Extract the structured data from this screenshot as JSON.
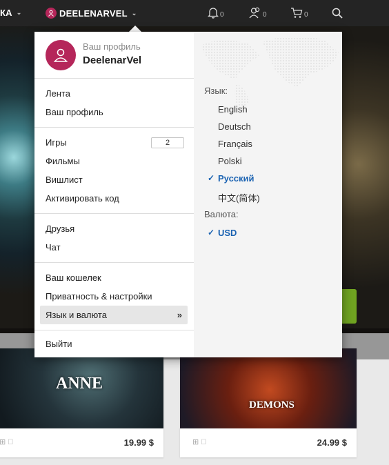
{
  "topbar": {
    "store_label": "КА",
    "username": "DEELENARVEL",
    "notifications_count": "0",
    "friends_count": "0",
    "cart_count": "0"
  },
  "profile": {
    "subtitle": "Ваш профиль",
    "name": "DeelenarVel"
  },
  "menu": {
    "group1": [
      "Лента",
      "Ваш профиль"
    ],
    "games_label": "Игры",
    "games_count": "2",
    "group2": [
      "Фильмы",
      "Вишлист",
      "Активировать код"
    ],
    "group3": [
      "Друзья",
      "Чат"
    ],
    "group4": [
      "Ваш кошелек",
      "Приватность & настройки"
    ],
    "language_currency": "Язык и валюта",
    "logout": "Выйти"
  },
  "settings": {
    "language_label": "Язык:",
    "languages": [
      "English",
      "Deutsch",
      "Français",
      "Polski",
      "Русский",
      "中文(简体)"
    ],
    "selected_language": "Русский",
    "currency_label": "Валюта:",
    "currencies": [
      "USD"
    ],
    "selected_currency": "USD"
  },
  "cards": [
    {
      "title_art": "ANNE",
      "price": "19.99 $"
    },
    {
      "title_art": "DEMONS",
      "price": "24.99 $"
    }
  ],
  "colors": {
    "topbar": "#242424",
    "accent_avatar": "#b5265a",
    "selected_blue": "#1b63b2",
    "cta_green": "#70a421"
  }
}
